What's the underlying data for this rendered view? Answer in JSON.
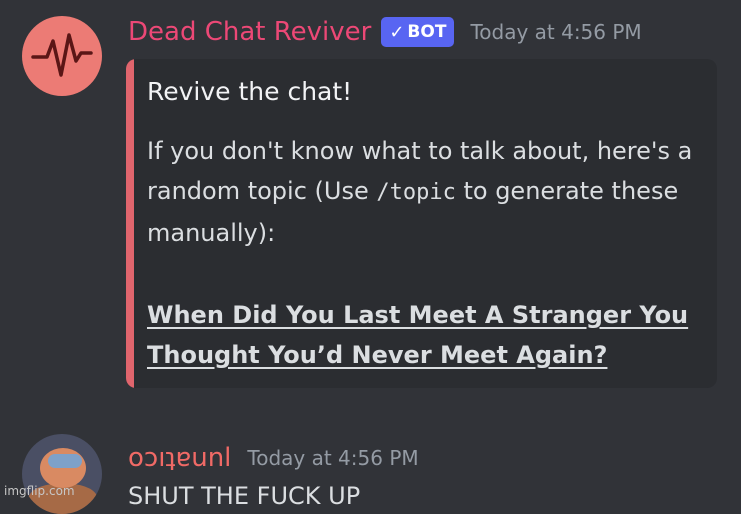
{
  "messages": [
    {
      "username": "Dead Chat Reviver",
      "badge": "BOT",
      "timestamp": "Today at 4:56 PM",
      "avatar_icon": "heartbeat-icon",
      "embed": {
        "accent_color": "#e0656d",
        "title": "Revive the chat!",
        "desc_before": "If you don't know what to talk about, here's a random topic (Use ",
        "command": "/topic",
        "desc_after": " to generate these manually):",
        "link": "When Did You Last Meet A Stranger You Thought You’d Never Meet Again?"
      }
    },
    {
      "username": "oɔıʇɐunl",
      "timestamp": "Today at 4:56 PM",
      "content": "SHUT THE FUCK UP"
    }
  ],
  "watermark": "imgflip.com",
  "colors": {
    "background": "#313338",
    "embed_bg": "#2b2d31",
    "bot_name": "#ec4876",
    "bot_badge": "#5865f2",
    "user_name": "#f06a66"
  }
}
